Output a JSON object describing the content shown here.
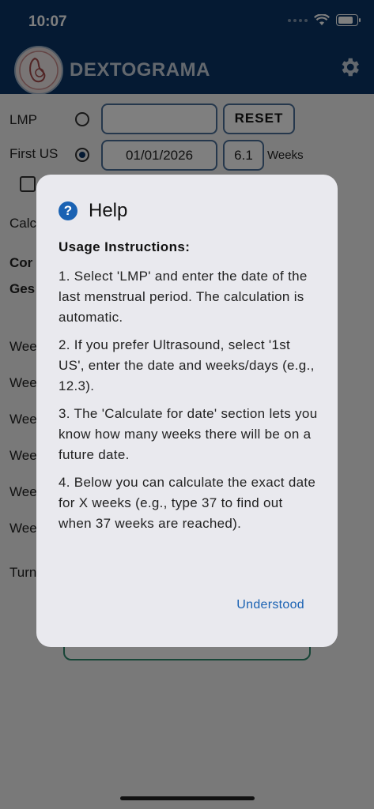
{
  "status": {
    "time": "10:07"
  },
  "app": {
    "title": "DEXTOGRAMA"
  },
  "form": {
    "lmp_label": "LMP",
    "lmp_value": "",
    "reset_label": "RESET",
    "first_us_label": "First US",
    "first_us_date": "01/01/2026",
    "first_us_weeks": "6.1",
    "weeks_suffix": "Weeks"
  },
  "background_rows": [
    {
      "label": "Calc"
    },
    {
      "label": "Cor"
    },
    {
      "label": "Ges"
    },
    {
      "label": "Wee"
    },
    {
      "label": "Wee"
    },
    {
      "label": "Wee"
    },
    {
      "label": "Wee"
    },
    {
      "label": "Wee"
    },
    {
      "label": "Wee"
    },
    {
      "label": "Turn"
    }
  ],
  "dialog": {
    "title": "Help",
    "heading": "Usage Instructions:",
    "paragraphs": [
      "1. Select 'LMP' and enter the date of the last menstrual period. The calculation is automatic.",
      "2. If you prefer Ultrasound, select '1st US', enter the date and weeks/days (e.g., 12.3).",
      "3. The 'Calculate for date' section lets you know how many weeks there will be on a future date.",
      "4. Below you can calculate the exact date for X weeks (e.g., type 37 to find out when 37 weeks are reached)."
    ],
    "confirm_label": "Understood"
  },
  "colors": {
    "header": "#0b3566",
    "accent": "#1a62b3",
    "dialog_bg": "#e9e9ee"
  },
  "icons": {
    "settings": "gear-icon",
    "help": "help-circle-icon"
  }
}
